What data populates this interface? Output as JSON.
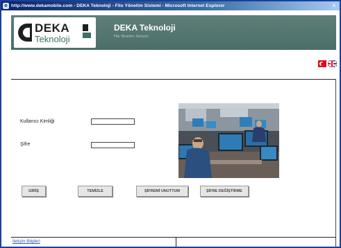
{
  "window": {
    "title": "http://www.dekamobile.com - DEKA Teknoloji - Filo Yönetim Sistemi - Microsoft Internet Explorer",
    "close_label": "x"
  },
  "header": {
    "logo_word1": "DEKA",
    "logo_word2": "Teknoloji",
    "company_name": "DEKA Teknoloji",
    "subtitle": "Filo Yönetim Sistemi"
  },
  "languages": [
    {
      "name": "turkish-flag"
    },
    {
      "name": "english-flag"
    }
  ],
  "login": {
    "username_label": "Kullanıcı Kimliği",
    "password_label": "Şifre",
    "username_value": "",
    "password_value": ""
  },
  "buttons": {
    "login": "GİRİŞ",
    "clear": "TEMİZLE",
    "forgot": "ŞİFREMİ UNUTTUM",
    "change": "ŞİFRE DEĞİŞTİRME"
  },
  "footer": {
    "contact_link": "İletişim Bilgileri"
  },
  "colors": {
    "header_bg": "#4c6e69",
    "titlebar": "#0a246a",
    "link": "#2e5aa8"
  }
}
